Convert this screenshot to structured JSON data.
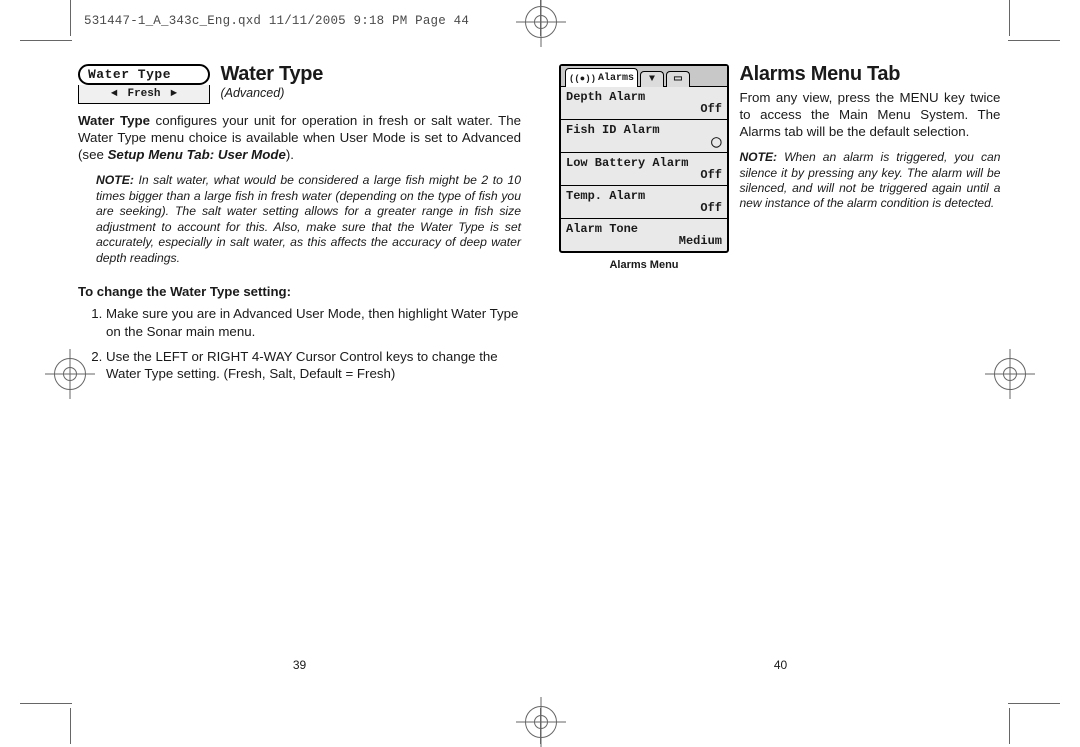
{
  "slug": "531447-1_A_343c_Eng.qxd  11/11/2005  9:18 PM  Page 44",
  "left": {
    "widget_title": "Water Type",
    "widget_value": "Fresh",
    "heading": "Water Type",
    "subhead": "(Advanced)",
    "p_bold": "Water Type",
    "p_rest1": " configures your unit for operation in fresh or salt water. The Water Type menu choice is available when User Mode is set to Advanced (see ",
    "p_ref": "Setup Menu Tab: User Mode",
    "p_rest2": ").",
    "note_label": "NOTE:",
    "note_text": "  In salt water, what would be considered a large fish might be 2 to 10 times bigger than a large fish in fresh water (depending on the type of fish you are seeking).  The salt water setting allows for a greater range in fish size adjustment to account for this.  Also, make sure that the Water Type is set accurately, especially in salt water, as this affects the accuracy of deep water depth readings.",
    "section_sub": "To change the Water Type setting:",
    "step1": "Make sure you are in Advanced User Mode, then highlight Water Type on the Sonar main menu.",
    "step2": "Use the LEFT or RIGHT 4-WAY Cursor Control keys to change the Water Type setting. (Fresh, Salt, Default = Fresh)",
    "page_num": "39"
  },
  "right": {
    "heading": "Alarms Menu Tab",
    "tab_label": "Alarms",
    "rows": {
      "depth_label": "Depth Alarm",
      "depth_val": "Off",
      "fish_label": "Fish ID Alarm",
      "lowbat_label": "Low Battery Alarm",
      "lowbat_val": "Off",
      "temp_label": "Temp. Alarm",
      "temp_val": "Off",
      "tone_label": "Alarm Tone",
      "tone_val": "Medium"
    },
    "lcd_caption": "Alarms Menu",
    "p1": "From any view, press the MENU key twice to access the Main Menu System. The Alarms tab will be the default selection.",
    "note_label": "NOTE:",
    "note_text": " When an alarm is triggered, you can silence it by pressing any key.  The alarm will be silenced, and will not be triggered again until a new instance of the alarm condition is detected.",
    "page_num": "40"
  }
}
